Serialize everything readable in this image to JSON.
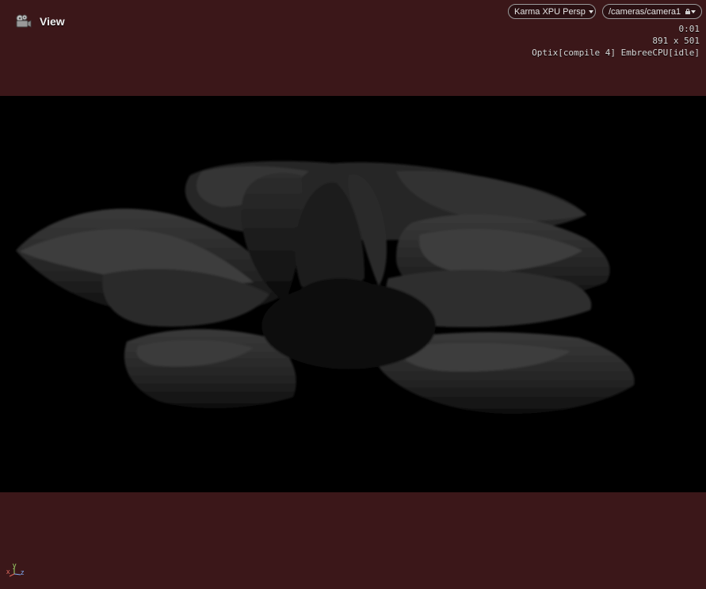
{
  "viewer": {
    "view_label": "View",
    "view_icon": "camera-icon",
    "renderer_label": "Karma XPU  Persp",
    "camera_path": "/cameras/camera1",
    "stats": {
      "time": "0:01",
      "resolution": "891 x 501",
      "engines": "Optix[compile 4] EmbreeCPU[idle]"
    },
    "axes": {
      "x": "x",
      "y": "y",
      "z": "z"
    }
  },
  "colors": {
    "background": "#3a1719",
    "render_bg": "#000000",
    "axis_x": "#e06a5e",
    "axis_y": "#9ed86a",
    "axis_z": "#7fa8ee"
  }
}
